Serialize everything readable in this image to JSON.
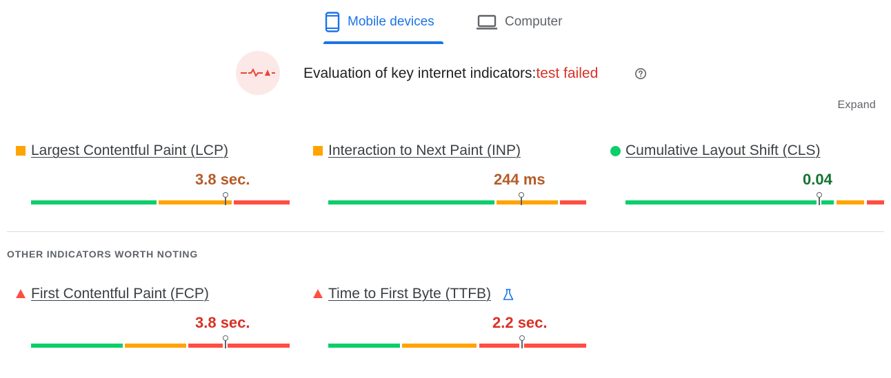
{
  "tabs": {
    "mobile": {
      "label": "Mobile devices",
      "icon": "smartphone-icon",
      "active": true
    },
    "computer": {
      "label": "Computer",
      "icon": "laptop-icon",
      "active": false
    }
  },
  "assessment": {
    "label": "Evaluation of key internet indicators:",
    "status": "test failed",
    "icon": "core-web-vitals-failed-icon"
  },
  "expand_label": "Expand",
  "core_metrics": [
    {
      "name": "Largest Contentful Paint (LCP)",
      "value": "3.8 sec.",
      "rating": "needs-improvement"
    },
    {
      "name": "Interaction to Next Paint (INP)",
      "value": "244 ms",
      "rating": "needs-improvement"
    },
    {
      "name": "Cumulative Layout Shift (CLS)",
      "value": "0.04",
      "rating": "good"
    }
  ],
  "other_section_title": "OTHER INDICATORS WORTH NOTING",
  "other_metrics": [
    {
      "name": "First Contentful Paint (FCP)",
      "value": "3.8 sec.",
      "rating": "poor"
    },
    {
      "name": "Time to First Byte (TTFB)",
      "value": "2.2 sec.",
      "rating": "poor",
      "experimental": true,
      "icon": "flask-icon"
    }
  ],
  "colors": {
    "accent": "#1a73e8",
    "good": "#0cce6b",
    "needs_improvement": "#ffa400",
    "poor": "#ff4e42",
    "fail_text": "#d93025"
  }
}
